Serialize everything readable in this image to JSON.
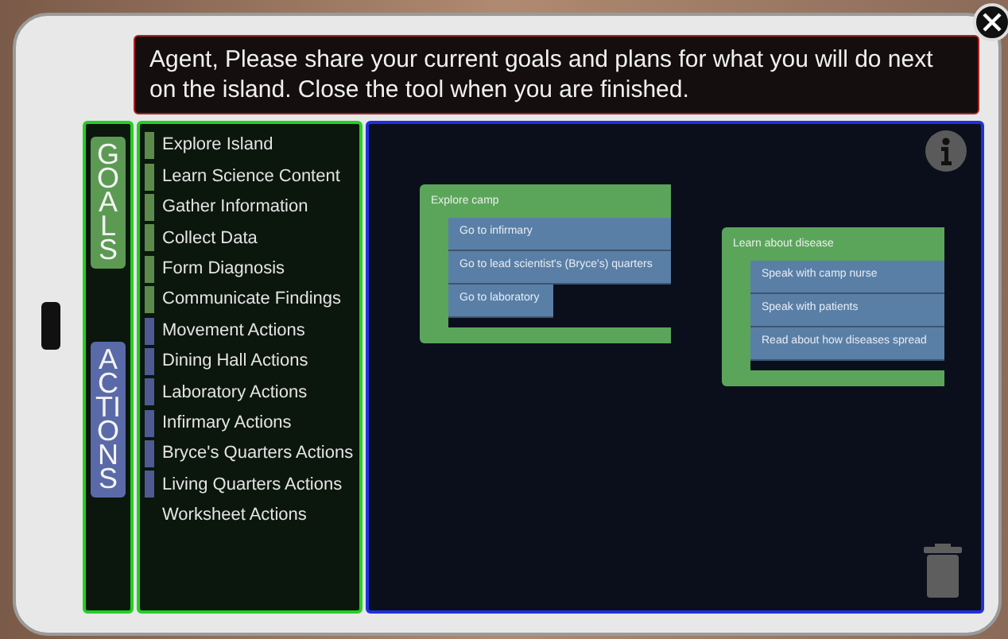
{
  "prompt": "Agent, Please share your current goals and plans for what you will do next on the island. Close the tool when you are finished.",
  "tabs": [
    {
      "label": "GOALS",
      "color": "#5c9a54"
    },
    {
      "label": "ACTIONS",
      "color": "#5a6aa8"
    }
  ],
  "categories": [
    {
      "label": "Explore Island",
      "color": "#5c8a4c"
    },
    {
      "label": "Learn Science Content",
      "color": "#5c8a4c"
    },
    {
      "label": "Gather Information",
      "color": "#5c8a4c"
    },
    {
      "label": "Collect Data",
      "color": "#5c8a4c"
    },
    {
      "label": "Form Diagnosis",
      "color": "#5c8a4c"
    },
    {
      "label": "Communicate Findings",
      "color": "#5c8a4c"
    },
    {
      "label": "Movement Actions",
      "color": "#4e5a92"
    },
    {
      "label": "Dining Hall Actions",
      "color": "#4e5a92"
    },
    {
      "label": "Laboratory Actions",
      "color": "#4e5a92"
    },
    {
      "label": "Infirmary Actions",
      "color": "#4e5a92"
    },
    {
      "label": "Bryce's Quarters Actions",
      "color": "#4e5a92"
    },
    {
      "label": "Living Quarters Actions",
      "color": "#4e5a92"
    },
    {
      "label": "Worksheet Actions"
    }
  ],
  "workspace": {
    "blocks": [
      {
        "label": "Explore camp",
        "children": [
          {
            "label": "Go to infirmary",
            "wide": true
          },
          {
            "label": "Go to lead scientist's (Bryce's) quarters",
            "wide": true
          },
          {
            "label": "Go to laboratory",
            "wide": false
          }
        ]
      },
      {
        "label": "Learn about disease",
        "children": [
          {
            "label": "Speak with camp nurse",
            "wide": true
          },
          {
            "label": "Speak with patients",
            "wide": true
          },
          {
            "label": "Read about how diseases spread",
            "wide": true
          }
        ]
      }
    ]
  }
}
